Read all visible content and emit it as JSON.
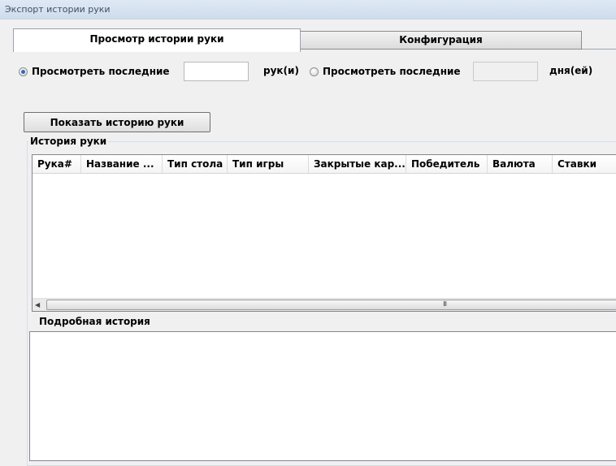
{
  "window": {
    "title": "Экспорт истории руки"
  },
  "tabs": [
    {
      "label": "Просмотр истории руки",
      "active": true
    },
    {
      "label": "Конфигурация",
      "active": false
    }
  ],
  "filter": {
    "option1_label": "Просмотреть последние",
    "option1_value": "",
    "option1_unit": "рук(и)",
    "option2_label": "Просмотреть последние",
    "option2_value": "",
    "option2_unit": "дня(ей)",
    "selected": "option1"
  },
  "show_button": {
    "label": "Показать историю руки"
  },
  "history_group": {
    "title": "История руки",
    "columns": [
      "Рука#",
      "Название ...",
      "Тип стола",
      "Тип игры",
      "Закрытые кар...",
      "Победитель",
      "Валюта",
      "Ставки"
    ],
    "rows": [],
    "scroll_grip": "III"
  },
  "detail": {
    "title": "Подробная история",
    "content": ""
  },
  "colors": {
    "radio_dot": "#2d6bb8",
    "window_bg": "#f0f0f0"
  }
}
